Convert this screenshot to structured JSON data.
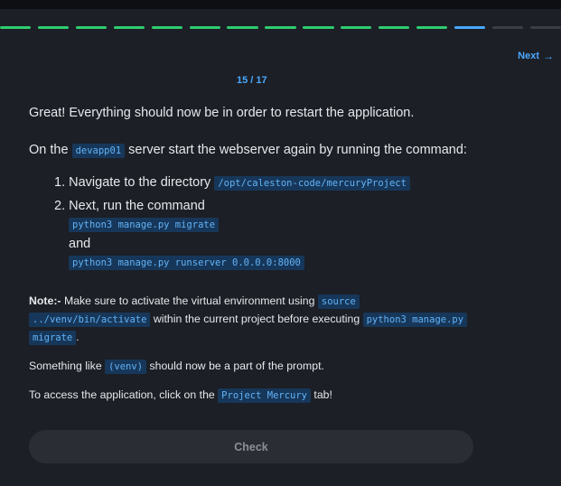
{
  "progress": {
    "completed_color": "#2ecc71",
    "current_color": "#4aa8ff",
    "remaining_color": "#3a3e45",
    "segments": [
      "done",
      "done",
      "done",
      "done",
      "done",
      "done",
      "done",
      "done",
      "done",
      "done",
      "done",
      "done",
      "current",
      "todo",
      "todo"
    ]
  },
  "nav": {
    "next_label": "Next",
    "next_icon": "arrow-right-icon"
  },
  "step_counter": "15 / 17",
  "content": {
    "intro": "Great! Everything should now be in order to restart the application.",
    "server_line": {
      "pre": "On the",
      "server": "devapp01",
      "post": "server start the webserver again by running the command:"
    },
    "steps": [
      {
        "number": "1.",
        "text": "Navigate to the directory",
        "code": "/opt/caleston-code/mercuryProject"
      },
      {
        "number": "2.",
        "text": "Next, run the command",
        "code1": "python3 manage.py migrate",
        "and": "and",
        "code2": "python3 manage.py runserver 0.0.0.0:8000"
      }
    ],
    "note": {
      "label": "Note:-",
      "text1": "Make sure to activate the virtual environment using",
      "code1a": "source",
      "code1b": "../venv/bin/activate",
      "text2": "within the current project before executing",
      "code2a": "python3 manage.py",
      "code2b": "migrate",
      "text3": "."
    },
    "venv_line": {
      "pre": "Something like",
      "code": "(venv)",
      "post": "should now be a part of the prompt."
    },
    "access_line": {
      "pre": "To access the application, click on the",
      "code": "Project Mercury",
      "post": "tab!"
    }
  },
  "check_button": "Check"
}
